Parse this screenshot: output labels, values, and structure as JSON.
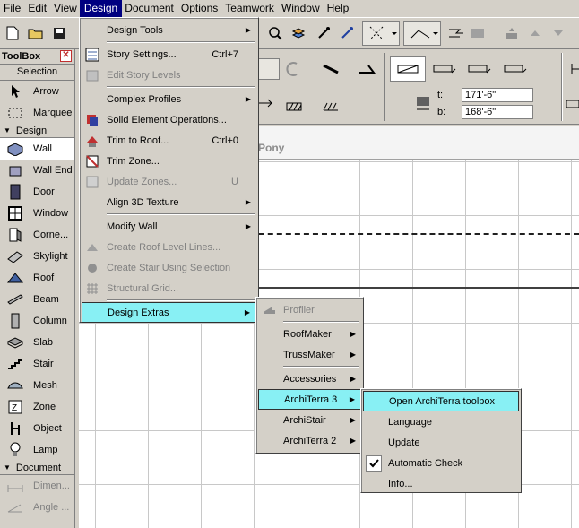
{
  "menubar": [
    "File",
    "Edit",
    "View",
    "Design",
    "Document",
    "Options",
    "Teamwork",
    "Window",
    "Help"
  ],
  "toolbar2": {
    "t_label": "t:",
    "t_value": "171'-6\"",
    "b_label": "b:",
    "b_value": "168'-6\""
  },
  "toolbox": {
    "title": "ToolBox",
    "close": "✕",
    "selection_header": "Selection",
    "selection_tools": [
      "Arrow",
      "Marquee"
    ],
    "design_header": "Design",
    "design_tools": [
      "Wall",
      "Wall End",
      "Door",
      "Window",
      "Corne...",
      "Skylight",
      "Roof",
      "Beam",
      "Column",
      "Slab",
      "Stair",
      "Mesh",
      "Zone",
      "Object",
      "Lamp"
    ],
    "document_header": "Document",
    "document_tools": [
      "Dimen...",
      "Angle ..."
    ]
  },
  "canvas": {
    "title": "Pony"
  },
  "design_menu": {
    "items": [
      {
        "label": "Design Tools",
        "shortcut": "",
        "submenu": true,
        "disabled": false,
        "icon": ""
      },
      {
        "sep": true
      },
      {
        "label": "Story Settings...",
        "shortcut": "Ctrl+7",
        "submenu": false,
        "disabled": false,
        "icon": "story-settings-icon"
      },
      {
        "label": "Edit Story Levels",
        "shortcut": "",
        "submenu": false,
        "disabled": true,
        "icon": "story-levels-icon"
      },
      {
        "sep": true
      },
      {
        "label": "Complex Profiles",
        "shortcut": "",
        "submenu": true,
        "disabled": false,
        "icon": ""
      },
      {
        "label": "Solid Element Operations...",
        "shortcut": "",
        "submenu": false,
        "disabled": false,
        "icon": "solid-ops-icon"
      },
      {
        "label": "Trim to Roof...",
        "shortcut": "Ctrl+0",
        "submenu": false,
        "disabled": false,
        "icon": "trim-roof-icon"
      },
      {
        "label": "Trim Zone...",
        "shortcut": "",
        "submenu": false,
        "disabled": false,
        "icon": "trim-zone-icon"
      },
      {
        "label": "Update Zones...",
        "shortcut": "U",
        "submenu": false,
        "disabled": true,
        "icon": "update-zones-icon"
      },
      {
        "label": "Align 3D Texture",
        "shortcut": "",
        "submenu": true,
        "disabled": false,
        "icon": ""
      },
      {
        "sep": true
      },
      {
        "label": "Modify Wall",
        "shortcut": "",
        "submenu": true,
        "disabled": false,
        "icon": ""
      },
      {
        "label": "Create Roof Level Lines...",
        "shortcut": "",
        "submenu": false,
        "disabled": true,
        "icon": "roof-lines-icon"
      },
      {
        "label": "Create Stair Using Selection",
        "shortcut": "",
        "submenu": false,
        "disabled": true,
        "icon": "stair-selection-icon"
      },
      {
        "label": "Structural Grid...",
        "shortcut": "",
        "submenu": false,
        "disabled": true,
        "icon": "structural-grid-icon"
      },
      {
        "sep": true
      },
      {
        "label": "Design Extras",
        "shortcut": "",
        "submenu": true,
        "disabled": false,
        "icon": "",
        "highlight": true
      }
    ]
  },
  "extras_menu": {
    "items": [
      {
        "label": "Profiler",
        "submenu": false,
        "disabled": true,
        "icon": "profiler-icon"
      },
      {
        "sep": true
      },
      {
        "label": "RoofMaker",
        "submenu": true,
        "disabled": false
      },
      {
        "label": "TrussMaker",
        "submenu": true,
        "disabled": false
      },
      {
        "sep": true
      },
      {
        "label": "Accessories",
        "submenu": true,
        "disabled": false
      },
      {
        "label": "ArchiTerra 3",
        "submenu": true,
        "disabled": false,
        "highlight": true
      },
      {
        "label": "ArchiStair",
        "submenu": true,
        "disabled": false
      },
      {
        "label": "ArchiTerra 2",
        "submenu": true,
        "disabled": false
      }
    ]
  },
  "architerra_menu": {
    "items": [
      {
        "label": "Open ArchiTerra toolbox",
        "highlight": true,
        "checked": false
      },
      {
        "label": "Language",
        "checked": false
      },
      {
        "label": "Update",
        "checked": false
      },
      {
        "label": "Automatic Check",
        "checked": true
      },
      {
        "label": "Info...",
        "checked": false
      }
    ]
  }
}
